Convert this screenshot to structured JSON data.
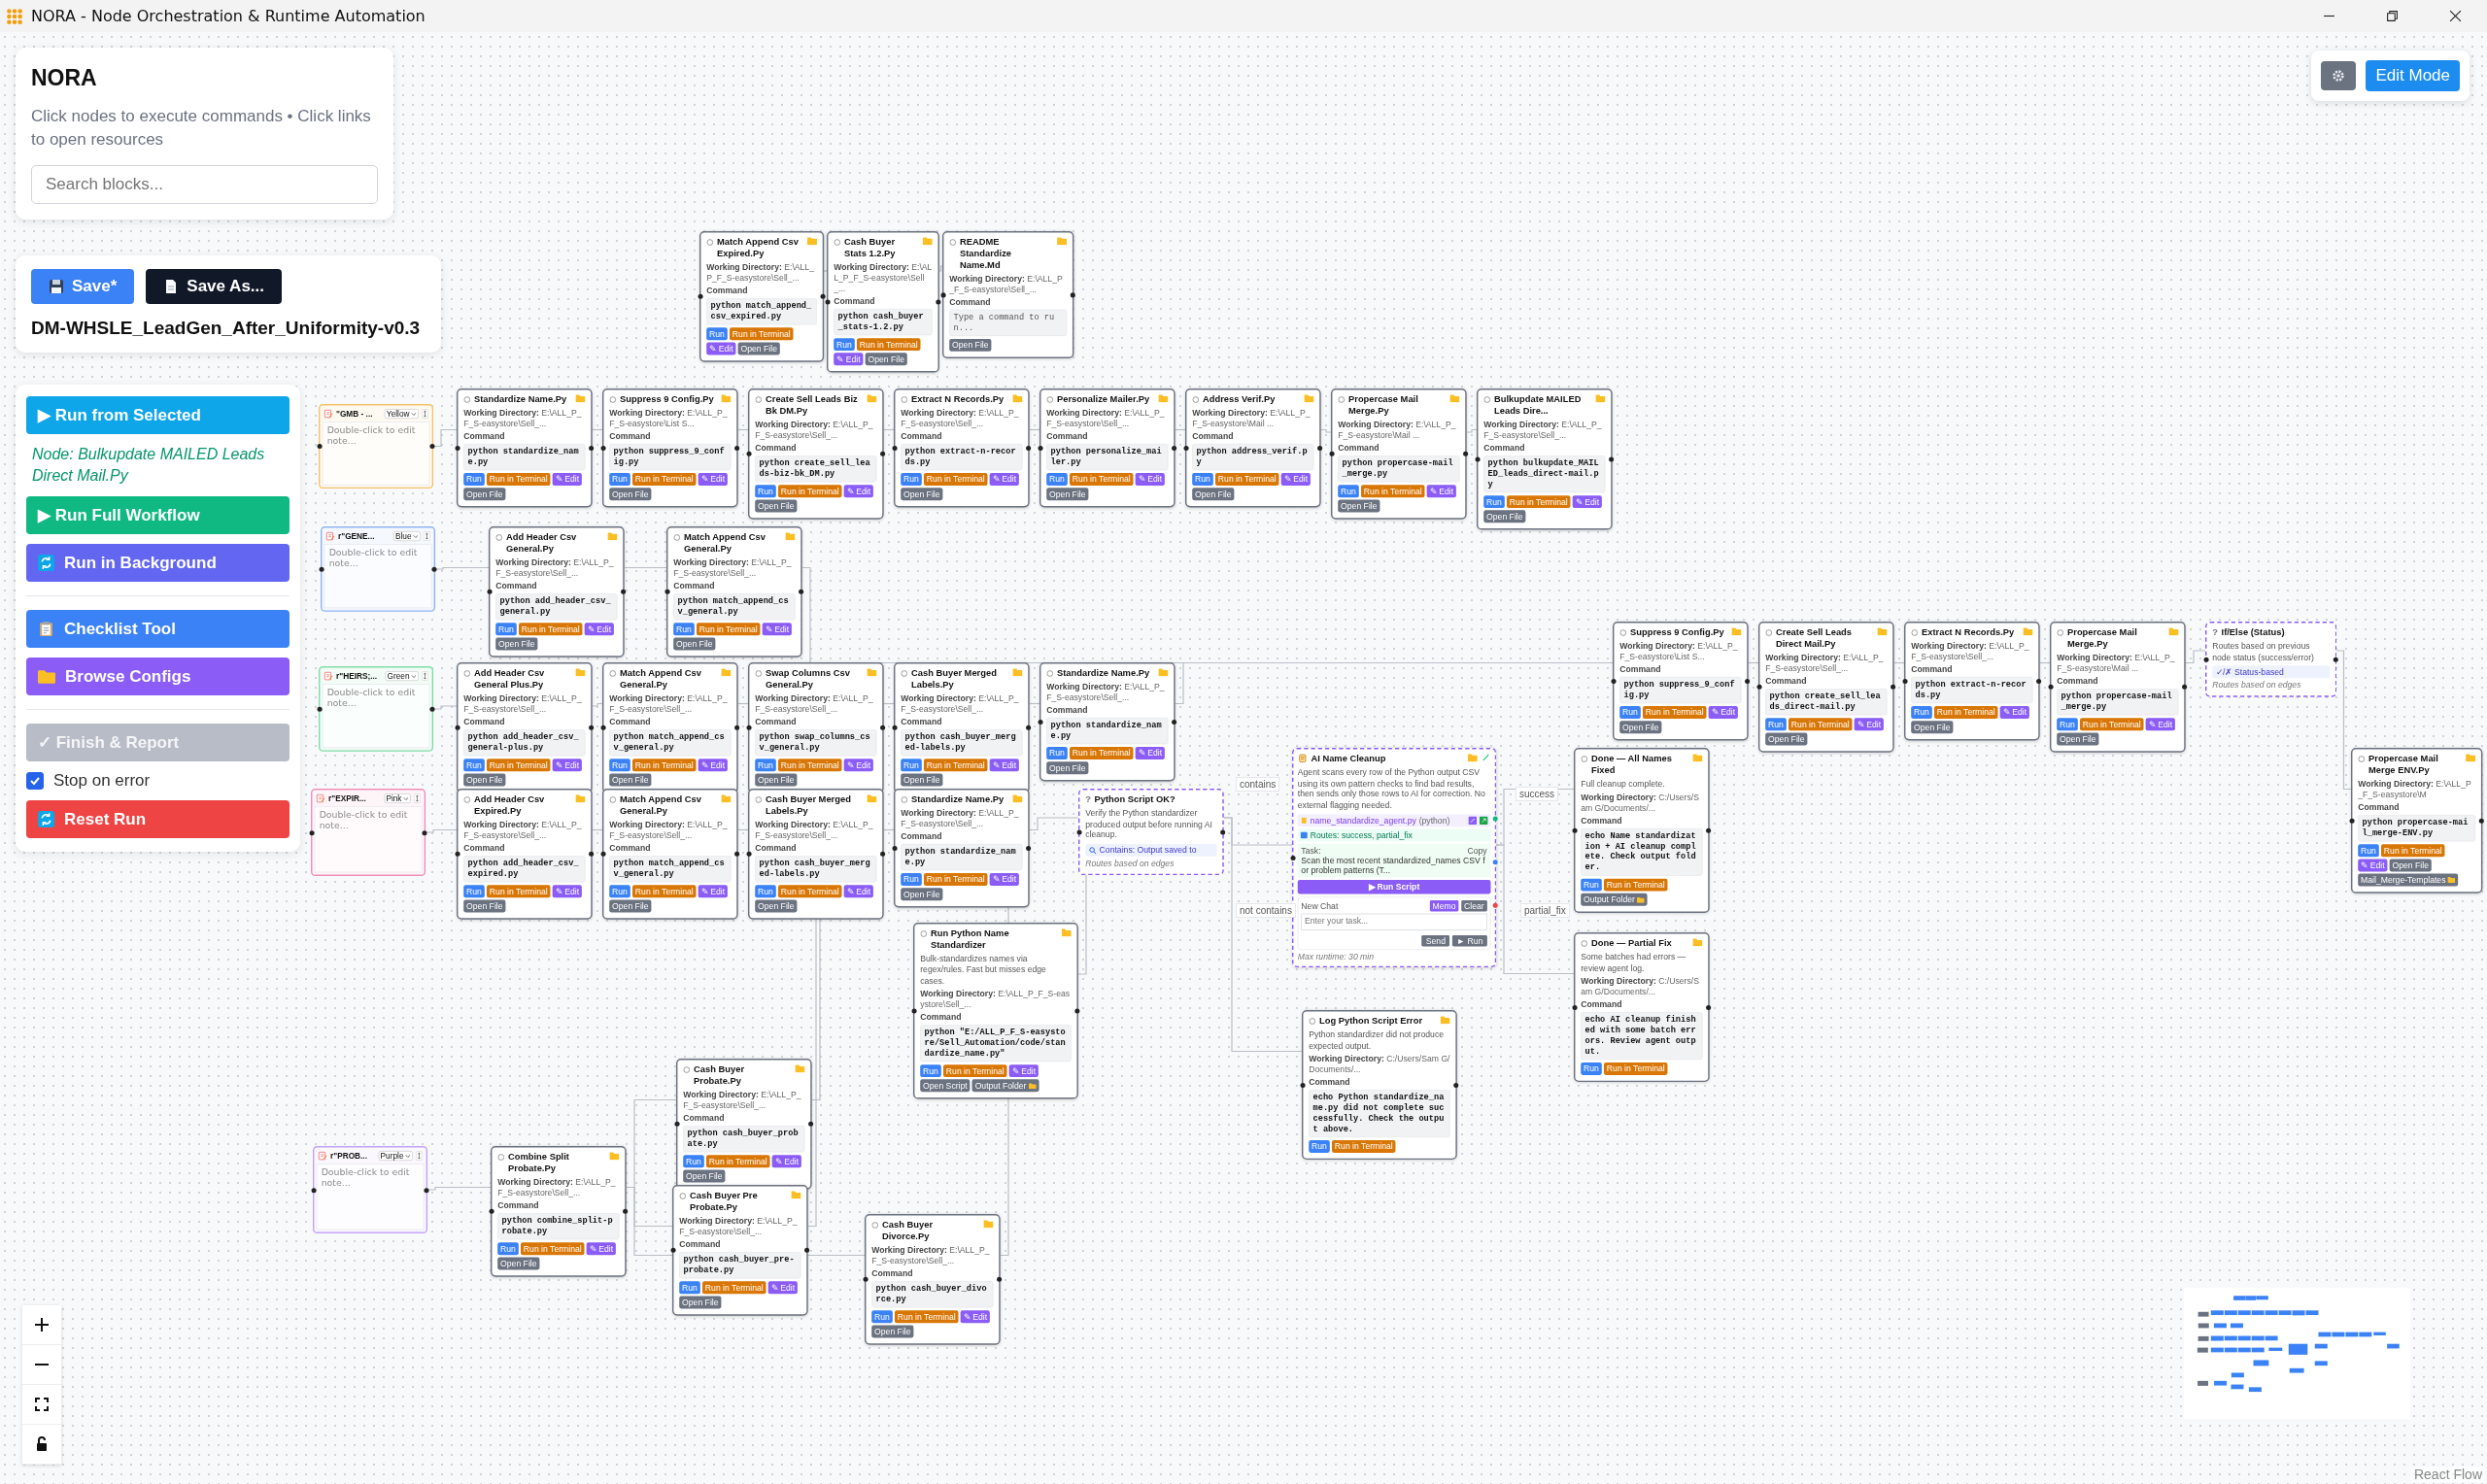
{
  "window": {
    "title": "NORA - Node Orchestration & Runtime Automation"
  },
  "header": {
    "title": "NORA",
    "subtitle": "Click nodes to execute commands • Click links to open resources",
    "search": {
      "placeholder": "Search blocks..."
    }
  },
  "file": {
    "buttons": [
      {
        "label": "Save*",
        "kind": "save"
      },
      {
        "label": "Save As...",
        "kind": "save_as"
      }
    ],
    "name": "DM-WHSLE_LeadGen_After_Uniformity-v0.3"
  },
  "actions": [
    [
      {
        "kind": "run_selected",
        "label": "▶ Run from Selected"
      },
      {
        "kind": "text",
        "label": "Node: Bulkupdate MAILED Leads Direct Mail.Py"
      },
      {
        "kind": "run_full",
        "label": "▶ Run Full Workflow"
      },
      {
        "kind": "run_background",
        "label": "Run in Background"
      }
    ],
    [
      {
        "kind": "checklist",
        "label": "Checklist Tool"
      },
      {
        "kind": "browse",
        "label": "Browse Configs"
      }
    ],
    [
      {
        "kind": "finish",
        "label": "✓ Finish & Report",
        "disabled": true
      },
      {
        "kind": "checkbox",
        "label": "Stop on error",
        "checked": true
      },
      {
        "kind": "reset",
        "label": "Reset Run"
      }
    ]
  ],
  "toolbar": {
    "edit_button": "Edit Mode"
  },
  "canvas": {
    "notes": [
      {
        "title": "\"GMB - ...",
        "option": "Yellow",
        "color": "#f5c26b",
        "placeholder": "Double-click to edit note..."
      },
      {
        "title": "r\"GENE...",
        "option": "Blue",
        "color": "#8fb3f2",
        "placeholder": "Double-click to edit note..."
      },
      {
        "title": "r\"HEIRS;...",
        "option": "Green",
        "color": "#7fdca8",
        "placeholder": "Double-click to edit note..."
      },
      {
        "title": "r\"EXPIR...",
        "option": "Pink",
        "color": "#ef8fba",
        "placeholder": "Double-click to edit note..."
      },
      {
        "title": "r\"PROB...",
        "option": "Purple",
        "color": "#c3a4f6",
        "placeholder": "Double-click to edit note..."
      }
    ],
    "nodes": [
      {
        "kind": "script",
        "title": "Match Append Csv Expired.Py",
        "dir": "**Working Directory:** E:\\ALL_P_F_S-easystore\\Sell_...",
        "command_label": "Command",
        "command": "python match_append_csv_expired.py",
        "buttons": [
          {
            "label": "Run",
            "kind": "run"
          },
          {
            "label": "Run in Terminal",
            "kind": "terminal"
          },
          {
            "label": "✎ Edit",
            "kind": "edit"
          },
          {
            "label": "Open File",
            "kind": "open"
          }
        ]
      },
      {
        "kind": "script",
        "title": "Cash Buyer Stats 1.2.Py",
        "dir": "**Working Directory:** E:\\ALL_P_F_S-easystore\\Sell_...",
        "command_label": "Command",
        "command": "python cash_buyer_stats-1.2.py",
        "buttons": [
          {
            "label": "Run",
            "kind": "run"
          },
          {
            "label": "Run in Terminal",
            "kind": "terminal"
          },
          {
            "label": "✎ Edit",
            "kind": "edit"
          },
          {
            "label": "Open File",
            "kind": "open"
          }
        ]
      },
      {
        "kind": "script",
        "title": "README Standardize Name.Md",
        "dir": "**Working Directory:** E:\\ALL_P_F_S-easystore\\Sell_...",
        "command_label": "Command",
        "command_placeholder": "Type a command to run...",
        "buttons": [
          {
            "label": "Open File",
            "kind": "open"
          }
        ]
      },
      {
        "kind": "script",
        "title": "Standardize Name.Py",
        "dir": "**Working Directory:** E:\\ALL_P_F_S-easystore\\Sell_...",
        "command_label": "Command",
        "command": "python standardize_name.py",
        "buttons": [
          {
            "label": "Run",
            "kind": "run"
          },
          {
            "label": "Run in Terminal",
            "kind": "terminal"
          },
          {
            "label": "✎ Edit",
            "kind": "edit"
          },
          {
            "label": "Open File",
            "kind": "open"
          }
        ]
      },
      {
        "kind": "script",
        "title": "Suppress 9 Config.Py",
        "dir": "**Working Directory:** E:\\ALL_P_F_S-easystore\\List S...",
        "command_label": "Command",
        "command": "python suppress_9_config.py",
        "buttons": [
          {
            "label": "Run",
            "kind": "run"
          },
          {
            "label": "Run in Terminal",
            "kind": "terminal"
          },
          {
            "label": "✎ Edit",
            "kind": "edit"
          },
          {
            "label": "Open File",
            "kind": "open"
          }
        ]
      },
      {
        "kind": "script",
        "title": "Create Sell Leads Biz Bk DM.Py",
        "dir": "**Working Directory:** E:\\ALL_P_F_S-easystore\\Sell_...",
        "command_label": "Command",
        "command": "python create_sell_leads-biz-bk_DM.py",
        "buttons": [
          {
            "label": "Run",
            "kind": "run"
          },
          {
            "label": "Run in Terminal",
            "kind": "terminal"
          },
          {
            "label": "✎ Edit",
            "kind": "edit"
          },
          {
            "label": "Open File",
            "kind": "open"
          }
        ]
      },
      {
        "kind": "script",
        "title": "Extract N Records.Py",
        "dir": "**Working Directory:** E:\\ALL_P_F_S-easystore\\Sell_...",
        "command_label": "Command",
        "command": "python extract-n-records.py",
        "buttons": [
          {
            "label": "Run",
            "kind": "run"
          },
          {
            "label": "Run in Terminal",
            "kind": "terminal"
          },
          {
            "label": "✎ Edit",
            "kind": "edit"
          },
          {
            "label": "Open File",
            "kind": "open"
          }
        ]
      },
      {
        "kind": "script",
        "title": "Personalize Mailer.Py",
        "dir": "**Working Directory:** E:\\ALL_P_F_S-easystore\\Sell_...",
        "command_label": "Command",
        "command": "python personalize_mailer.py",
        "buttons": [
          {
            "label": "Run",
            "kind": "run"
          },
          {
            "label": "Run in Terminal",
            "kind": "terminal"
          },
          {
            "label": "✎ Edit",
            "kind": "edit"
          },
          {
            "label": "Open File",
            "kind": "open"
          }
        ]
      },
      {
        "kind": "script",
        "title": "Address Verif.Py",
        "dir": "**Working Directory:** E:\\ALL_P_F_S-easystore\\Mail ...",
        "command_label": "Command",
        "command": "python address_verif.py",
        "buttons": [
          {
            "label": "Run",
            "kind": "run"
          },
          {
            "label": "Run in Terminal",
            "kind": "terminal"
          },
          {
            "label": "✎ Edit",
            "kind": "edit"
          },
          {
            "label": "Open File",
            "kind": "open"
          }
        ]
      },
      {
        "kind": "script",
        "title": "Propercase Mail Merge.Py",
        "dir": "**Working Directory:** E:\\ALL_P_F_S-easystore\\Mail ...",
        "command_label": "Command",
        "command": "python propercase-mail_merge.py",
        "buttons": [
          {
            "label": "Run",
            "kind": "run"
          },
          {
            "label": "Run in Terminal",
            "kind": "terminal"
          },
          {
            "label": "✎ Edit",
            "kind": "edit"
          },
          {
            "label": "Open File",
            "kind": "open"
          }
        ]
      },
      {
        "kind": "script",
        "title": "Bulkupdate MAILED Leads Dire...",
        "dir": "**Working Directory:** E:\\ALL_P_F_S-easystore\\Sell_...",
        "command_label": "Command",
        "command": "python bulkupdate_MAILED_leads_direct-mail.py",
        "buttons": [
          {
            "label": "Run",
            "kind": "run"
          },
          {
            "label": "Run in Terminal",
            "kind": "terminal"
          },
          {
            "label": "✎ Edit",
            "kind": "edit"
          },
          {
            "label": "Open File",
            "kind": "open"
          }
        ]
      },
      {
        "kind": "script",
        "title": "Add Header Csv General.Py",
        "dir": "**Working Directory:** E:\\ALL_P_F_S-easystore\\Sell_...",
        "command_label": "Command",
        "command": "python add_header_csv_general.py",
        "buttons": [
          {
            "label": "Run",
            "kind": "run"
          },
          {
            "label": "Run in Terminal",
            "kind": "terminal"
          },
          {
            "label": "✎ Edit",
            "kind": "edit"
          },
          {
            "label": "Open File",
            "kind": "open"
          }
        ]
      },
      {
        "kind": "script",
        "title": "Match Append Csv General.Py",
        "dir": "**Working Directory:** E:\\ALL_P_F_S-easystore\\Sell_...",
        "command_label": "Command",
        "command": "python match_append_csv_general.py",
        "buttons": [
          {
            "label": "Run",
            "kind": "run"
          },
          {
            "label": "Run in Terminal",
            "kind": "terminal"
          },
          {
            "label": "✎ Edit",
            "kind": "edit"
          },
          {
            "label": "Open File",
            "kind": "open"
          }
        ]
      },
      {
        "kind": "script",
        "title": "Add Header Csv General Plus.Py",
        "dir": "**Working Directory:** E:\\ALL_P_F_S-easystore\\Sell_...",
        "command_label": "Command",
        "command": "python add_header_csv_general-plus.py",
        "buttons": [
          {
            "label": "Run",
            "kind": "run"
          },
          {
            "label": "Run in Terminal",
            "kind": "terminal"
          },
          {
            "label": "✎ Edit",
            "kind": "edit"
          },
          {
            "label": "Open File",
            "kind": "open"
          }
        ]
      },
      {
        "kind": "script",
        "title": "Match Append Csv General.Py",
        "dir": "**Working Directory:** E:\\ALL_P_F_S-easystore\\Sell_...",
        "command_label": "Command",
        "command": "python match_append_csv_general.py",
        "buttons": [
          {
            "label": "Run",
            "kind": "run"
          },
          {
            "label": "Run in Terminal",
            "kind": "terminal"
          },
          {
            "label": "✎ Edit",
            "kind": "edit"
          },
          {
            "label": "Open File",
            "kind": "open"
          }
        ]
      },
      {
        "kind": "script",
        "title": "Swap Columns Csv General.Py",
        "dir": "**Working Directory:** E:\\ALL_P_F_S-easystore\\Sell_...",
        "command_label": "Command",
        "command": "python swap_columns_csv_general.py",
        "buttons": [
          {
            "label": "Run",
            "kind": "run"
          },
          {
            "label": "Run in Terminal",
            "kind": "terminal"
          },
          {
            "label": "✎ Edit",
            "kind": "edit"
          },
          {
            "label": "Open File",
            "kind": "open"
          }
        ]
      },
      {
        "kind": "script",
        "title": "Cash Buyer Merged Labels.Py",
        "dir": "**Working Directory:** E:\\ALL_P_F_S-easystore\\Sell_...",
        "command_label": "Command",
        "command": "python cash_buyer_merged-labels.py",
        "buttons": [
          {
            "label": "Run",
            "kind": "run"
          },
          {
            "label": "Run in Terminal",
            "kind": "terminal"
          },
          {
            "label": "✎ Edit",
            "kind": "edit"
          },
          {
            "label": "Open File",
            "kind": "open"
          }
        ]
      },
      {
        "kind": "script",
        "title": "Standardize Name.Py",
        "dir": "**Working Directory:** E:\\ALL_P_F_S-easystore\\Sell_...",
        "command_label": "Command",
        "command": "python standardize_name.py",
        "buttons": [
          {
            "label": "Run",
            "kind": "run"
          },
          {
            "label": "Run in Terminal",
            "kind": "terminal"
          },
          {
            "label": "✎ Edit",
            "kind": "edit"
          },
          {
            "label": "Open File",
            "kind": "open"
          }
        ]
      },
      {
        "kind": "script",
        "title": "Suppress 9 Config.Py",
        "dir": "**Working Directory:** E:\\ALL_P_F_S-easystore\\List S...",
        "command_label": "Command",
        "command": "python suppress_9_config.py",
        "buttons": [
          {
            "label": "Run",
            "kind": "run"
          },
          {
            "label": "Run in Terminal",
            "kind": "terminal"
          },
          {
            "label": "✎ Edit",
            "kind": "edit"
          },
          {
            "label": "Open File",
            "kind": "open"
          }
        ]
      },
      {
        "kind": "script",
        "title": "Create Sell Leads Direct Mail.Py",
        "dir": "**Working Directory:** E:\\ALL_P_F_S-easystore\\Sell_...",
        "command_label": "Command",
        "command": "python create_sell_leads_direct-mail.py",
        "buttons": [
          {
            "label": "Run",
            "kind": "run"
          },
          {
            "label": "Run in Terminal",
            "kind": "terminal"
          },
          {
            "label": "✎ Edit",
            "kind": "edit"
          },
          {
            "label": "Open File",
            "kind": "open"
          }
        ]
      },
      {
        "kind": "script",
        "title": "Extract N Records.Py",
        "dir": "**Working Directory:** E:\\ALL_P_F_S-easystore\\Sell_...",
        "command_label": "Command",
        "command": "python extract-n-records.py",
        "buttons": [
          {
            "label": "Run",
            "kind": "run"
          },
          {
            "label": "Run in Terminal",
            "kind": "terminal"
          },
          {
            "label": "✎ Edit",
            "kind": "edit"
          },
          {
            "label": "Open File",
            "kind": "open"
          }
        ]
      },
      {
        "kind": "script",
        "title": "Propercase Mail Merge.Py",
        "dir": "**Working Directory:** E:\\ALL_P_F_S-easystore\\Mail ...",
        "command_label": "Command",
        "command": "python propercase-mail_merge.py",
        "buttons": [
          {
            "label": "Run",
            "kind": "run"
          },
          {
            "label": "Run in Terminal",
            "kind": "terminal"
          },
          {
            "label": "✎ Edit",
            "kind": "edit"
          },
          {
            "label": "Open File",
            "kind": "open"
          }
        ]
      },
      {
        "kind": "condition",
        "icon": "?",
        "title": "If/Else (Status)",
        "description": "Routes based on previous node status (success/error)",
        "search_icon": false,
        "rule": "✓/✗ Status-based",
        "footer": "Routes based on edges"
      },
      {
        "kind": "script",
        "title": "Add Header Csv Expired.Py",
        "dir": "**Working Directory:** E:\\ALL_P_F_S-easystore\\Sell_...",
        "command_label": "Command",
        "command": "python add_header_csv_expired.py",
        "buttons": [
          {
            "label": "Run",
            "kind": "run"
          },
          {
            "label": "Run in Terminal",
            "kind": "terminal"
          },
          {
            "label": "✎ Edit",
            "kind": "edit"
          },
          {
            "label": "Open File",
            "kind": "open"
          }
        ]
      },
      {
        "kind": "script",
        "title": "Match Append Csv General.Py",
        "dir": "**Working Directory:** E:\\ALL_P_F_S-easystore\\Sell_...",
        "command_label": "Command",
        "command": "python match_append_csv_general.py",
        "buttons": [
          {
            "label": "Run",
            "kind": "run"
          },
          {
            "label": "Run in Terminal",
            "kind": "terminal"
          },
          {
            "label": "✎ Edit",
            "kind": "edit"
          },
          {
            "label": "Open File",
            "kind": "open"
          }
        ]
      },
      {
        "kind": "script",
        "title": "Cash Buyer Merged Labels.Py",
        "dir": "**Working Directory:** E:\\ALL_P_F_S-easystore\\Sell_...",
        "command_label": "Command",
        "command": "python cash_buyer_merged-labels.py",
        "buttons": [
          {
            "label": "Run",
            "kind": "run"
          },
          {
            "label": "Run in Terminal",
            "kind": "terminal"
          },
          {
            "label": "✎ Edit",
            "kind": "edit"
          },
          {
            "label": "Open File",
            "kind": "open"
          }
        ]
      },
      {
        "kind": "script",
        "title": "Standardize Name.Py",
        "dir": "**Working Directory:** E:\\ALL_P_F_S-easystore\\Sell_...",
        "command_label": "Command",
        "command": "python standardize_name.py",
        "buttons": [
          {
            "label": "Run",
            "kind": "run"
          },
          {
            "label": "Run in Terminal",
            "kind": "terminal"
          },
          {
            "label": "✎ Edit",
            "kind": "edit"
          },
          {
            "label": "Open File",
            "kind": "open"
          }
        ]
      },
      {
        "kind": "condition",
        "icon": "?",
        "title": "Python Script OK?",
        "description": "Verify the Python standardizer produced output before running AI cleanup.",
        "search_icon": true,
        "rule": "Contains: Output saved to",
        "footer": "Routes based on edges"
      },
      {
        "kind": "agent",
        "title": "AI Name Cleanup",
        "description": "Agent scans every row of the Python output CSV using its own pattern checks to find bad results, then sends only those rows to AI for correction. No external flagging needed.",
        "script": "name_standardize_agent.py",
        "lang": "(python)",
        "routes": "Routes: success, partial_fix",
        "task_label": "Task:",
        "copy": "Copy",
        "task": "Scan the most recent standardized_names CSV for problem patterns (T...",
        "run_button": "▶ Run Script",
        "chat_label": "New Chat",
        "chat_buttons": [
          "Memo",
          "Clear"
        ],
        "chat_placeholder": "Enter your task...",
        "send": "Send",
        "run": "► Run",
        "footer": "Max runtime: 30 min"
      },
      {
        "kind": "script",
        "title": "Done — All Names Fixed",
        "description": "Full cleanup complete.",
        "dir": "**Working Directory:** C:/Users/Sam G/Documents/...",
        "command_label": "Command",
        "command": "echo Name standardization + AI cleanup complete. Check output folder.",
        "buttons": [
          {
            "label": "Run",
            "kind": "run"
          },
          {
            "label": "Run in Terminal",
            "kind": "terminal"
          },
          {
            "label": "Output Folder",
            "kind": "folder"
          }
        ]
      },
      {
        "kind": "script",
        "title": "Propercase Mail Merge ENV.Py",
        "dir": "**Working Directory:** E:\\ALL_P_F_S-easystore\\M",
        "command_label": "Command",
        "command": "python propercase-mail_merge-ENV.py",
        "buttons": [
          {
            "label": "Run",
            "kind": "run"
          },
          {
            "label": "Run in Terminal",
            "kind": "terminal"
          },
          {
            "label": "✎ Edit",
            "kind": "edit"
          },
          {
            "label": "Open File",
            "kind": "open"
          },
          {
            "label": "Mail_Merge-Templates",
            "kind": "folder"
          }
        ]
      },
      {
        "kind": "script",
        "title": "Run Python Name Standardizer",
        "description": "Bulk-standardizes names via regex/rules. Fast but misses edge cases.",
        "dir": "**Working Directory:** E:\\ALL_P_F_S-easystore\\Sell_...",
        "command_label": "Command",
        "command": "python \"E:/ALL_P_F_S-easystore/Sell_Automation/code/standardize_name.py\"",
        "buttons": [
          {
            "label": "Run",
            "kind": "run"
          },
          {
            "label": "Run in Terminal",
            "kind": "terminal"
          },
          {
            "label": "✎ Edit",
            "kind": "edit"
          },
          {
            "label": "Open Script",
            "kind": "open"
          },
          {
            "label": "Output Folder",
            "kind": "folder"
          }
        ]
      },
      {
        "kind": "script",
        "title": "Done — Partial Fix",
        "description": "Some batches had errors — review agent log.",
        "dir": "**Working Directory:** C:/Users/Sam G/Documents/...",
        "command_label": "Command",
        "command": "echo AI cleanup finished with some batch errors. Review agent output.",
        "buttons": [
          {
            "label": "Run",
            "kind": "run"
          },
          {
            "label": "Run in Terminal",
            "kind": "terminal"
          }
        ]
      },
      {
        "kind": "script",
        "title": "Log Python Script Error",
        "description": "Python standardizer did not produce expected output.",
        "dir": "**Working Directory:** C:/Users/Sam G/Documents/...",
        "command_label": "Command",
        "command": "echo Python standardize_name.py did not complete successfully. Check the output above.",
        "buttons": [
          {
            "label": "Run",
            "kind": "run"
          },
          {
            "label": "Run in Terminal",
            "kind": "terminal"
          }
        ]
      },
      {
        "kind": "script",
        "title": "Cash Buyer Probate.Py",
        "dir": "**Working Directory:** E:\\ALL_P_F_S-easystore\\Sell_...",
        "command_label": "Command",
        "command": "python cash_buyer_probate.py",
        "buttons": [
          {
            "label": "Run",
            "kind": "run"
          },
          {
            "label": "Run in Terminal",
            "kind": "terminal"
          },
          {
            "label": "✎ Edit",
            "kind": "edit"
          },
          {
            "label": "Open File",
            "kind": "open"
          }
        ]
      },
      {
        "kind": "script",
        "title": "Combine Split Probate.Py",
        "dir": "**Working Directory:** E:\\ALL_P_F_S-easystore\\Sell_...",
        "command_label": "Command",
        "command": "python combine_split-probate.py",
        "buttons": [
          {
            "label": "Run",
            "kind": "run"
          },
          {
            "label": "Run in Terminal",
            "kind": "terminal"
          },
          {
            "label": "✎ Edit",
            "kind": "edit"
          },
          {
            "label": "Open File",
            "kind": "open"
          }
        ]
      },
      {
        "kind": "script",
        "title": "Cash Buyer Pre Probate.Py",
        "dir": "**Working Directory:** E:\\ALL_P_F_S-easystore\\Sell_...",
        "command_label": "Command",
        "command": "python cash_buyer_pre-probate.py",
        "buttons": [
          {
            "label": "Run",
            "kind": "run"
          },
          {
            "label": "Run in Terminal",
            "kind": "terminal"
          },
          {
            "label": "✎ Edit",
            "kind": "edit"
          },
          {
            "label": "Open File",
            "kind": "open"
          }
        ]
      },
      {
        "kind": "script",
        "title": "Cash Buyer Divorce.Py",
        "dir": "**Working Directory:** E:\\ALL_P_F_S-easystore\\Sell_...",
        "command_label": "Command",
        "command": "python cash_buyer_divorce.py",
        "buttons": [
          {
            "label": "Run",
            "kind": "run"
          },
          {
            "label": "Run in Terminal",
            "kind": "terminal"
          },
          {
            "label": "✎ Edit",
            "kind": "edit"
          },
          {
            "label": "Open File",
            "kind": "open"
          }
        ]
      }
    ],
    "edge_labels": [
      "contains",
      "success",
      "not contains",
      "partial_fix"
    ]
  },
  "attribution": "React Flow"
}
